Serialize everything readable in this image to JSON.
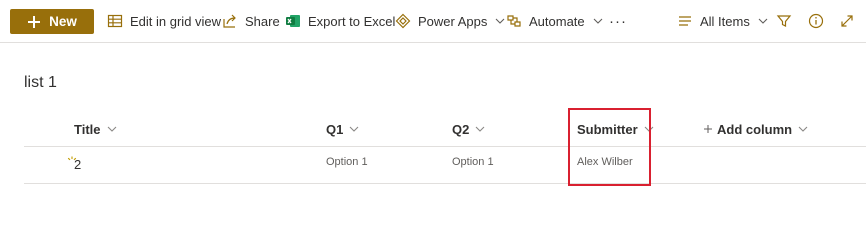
{
  "toolbar": {
    "new_label": "New",
    "edit_grid_label": "Edit in grid view",
    "share_label": "Share",
    "export_label": "Export to Excel",
    "power_apps_label": "Power Apps",
    "automate_label": "Automate",
    "more_label": "···",
    "view_label": "All Items"
  },
  "list": {
    "title": "list 1",
    "columns": [
      "Title",
      "Q1",
      "Q2",
      "Submitter",
      "Add column"
    ],
    "rows": [
      {
        "title": "2",
        "q1": "Option 1",
        "q2": "Option 1",
        "submitter": "Alex Wilber"
      }
    ]
  },
  "icons": {
    "new": "plus-icon",
    "edit_grid": "grid-icon",
    "share": "share-icon",
    "export": "excel-icon",
    "power_apps": "power-apps-icon",
    "automate": "automate-icon",
    "view": "view-lines-icon",
    "filter": "filter-icon",
    "info": "info-icon",
    "expand": "expand-icon"
  },
  "colors": {
    "accent": "#986f0b",
    "highlight_box": "#d92030",
    "excel_green": "#107c41"
  }
}
